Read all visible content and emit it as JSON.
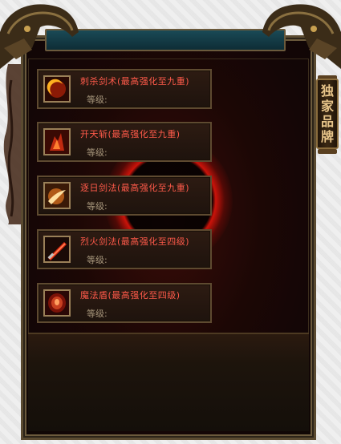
{
  "banner": {
    "chars": [
      "独",
      "家",
      "品",
      "牌"
    ]
  },
  "skills": [
    {
      "name": "刺杀剑术(最高强化至九重)",
      "level_label": "等级:",
      "icon": "crescent-strike-icon"
    },
    {
      "name": "开天斩(最高强化至九重)",
      "level_label": "等级:",
      "icon": "sky-cleave-icon"
    },
    {
      "name": "逐日剑法(最高强化至九重)",
      "level_label": "等级:",
      "icon": "sun-chase-sword-icon"
    },
    {
      "name": "烈火剑法(最高强化至四级)",
      "level_label": "等级:",
      "icon": "blazing-sword-icon"
    },
    {
      "name": "魔法盾(最高强化至四级)",
      "level_label": "等级:",
      "icon": "magic-shield-icon"
    }
  ],
  "colors": {
    "skill_name": "#ff5a4a",
    "level_label": "#a8977c",
    "frame_gold": "#6b5a3c",
    "top_bar": "#1a4a56",
    "banner_text": "#e8c58a"
  }
}
